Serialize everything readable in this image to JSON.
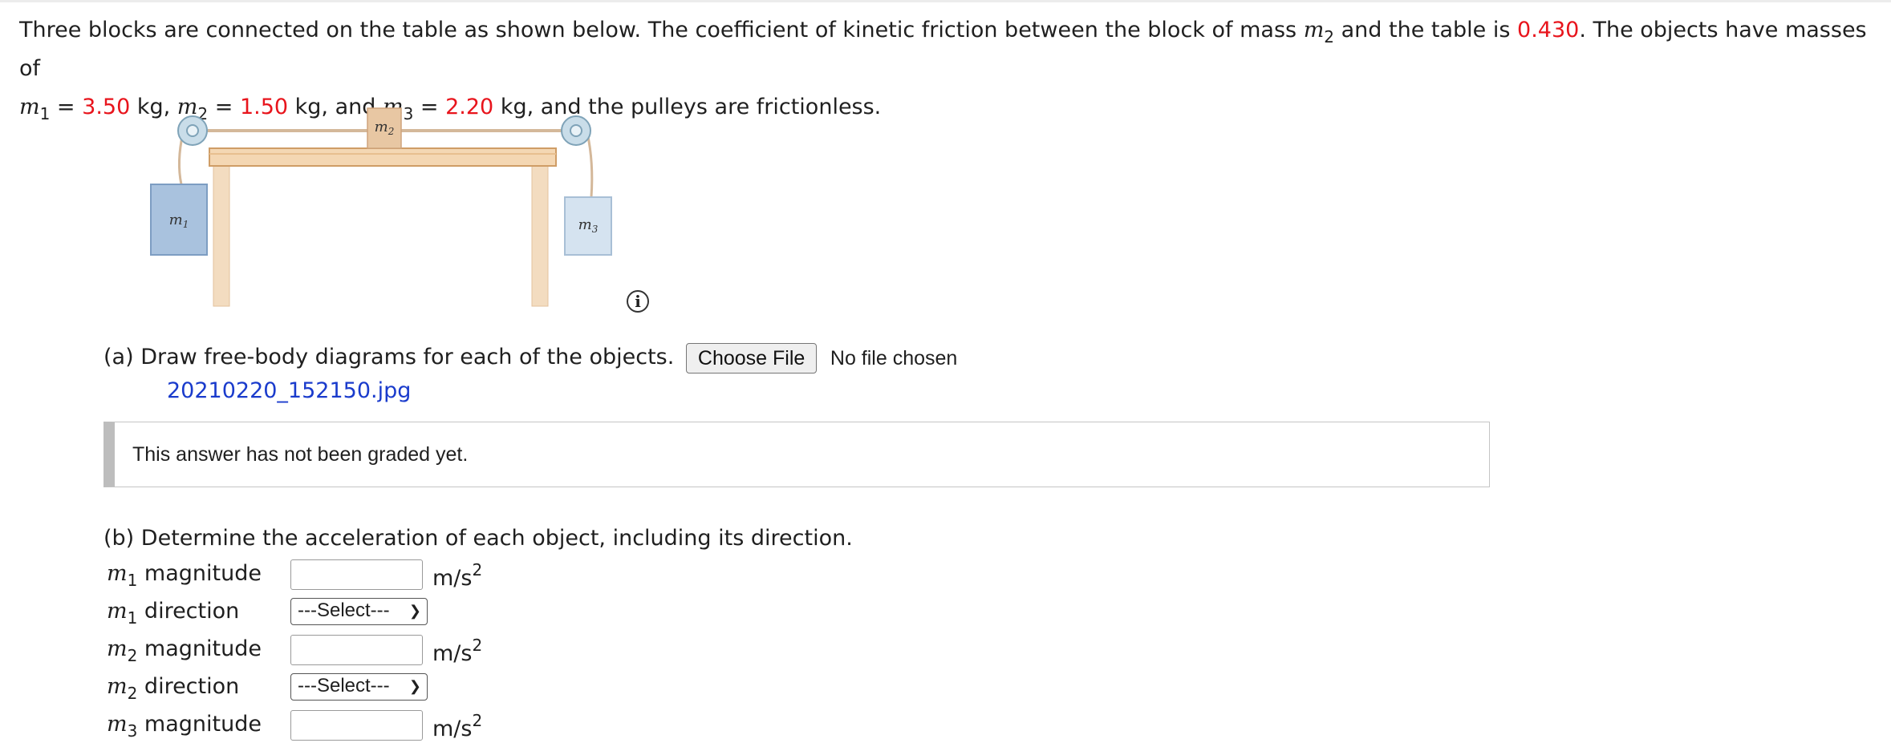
{
  "problem": {
    "intro": "Three blocks are connected on the table as shown below. The coefficient of kinetic friction between the block of mass ",
    "mid": " and the table is ",
    "mu": "0.430",
    "end": ". The objects have masses of",
    "m1_eq": " = ",
    "m1": "3.50",
    "kg1": " kg, ",
    "m2": "1.50",
    "kg2": " kg, and ",
    "m3": "2.20",
    "tail": " kg, and the pulleys are frictionless.",
    "var_m": "m",
    "sub1": "1",
    "sub2": "2",
    "sub3": "3"
  },
  "figure": {
    "label_m1": "m",
    "label_m2": "m",
    "label_m3": "m",
    "sub1": "1",
    "sub2": "2",
    "sub3": "3"
  },
  "info_icon": "i",
  "part_a": {
    "prompt": "(a) Draw free-body diagrams for each of the objects.",
    "button": "Choose File",
    "status": "No file chosen",
    "uploaded": "20210220_152150.jpg",
    "grade_note": "This answer has not been graded yet."
  },
  "part_b": {
    "prompt": "(b) Determine the acceleration of each object, including its direction.",
    "rows": [
      {
        "var": "m",
        "sub": "1",
        "label": " magnitude",
        "unit": "m/s",
        "exp": "2"
      },
      {
        "var": "m",
        "sub": "1",
        "label": " direction",
        "select": "---Select---"
      },
      {
        "var": "m",
        "sub": "2",
        "label": " magnitude",
        "unit": "m/s",
        "exp": "2"
      },
      {
        "var": "m",
        "sub": "2",
        "label": " direction",
        "select": "---Select---"
      },
      {
        "var": "m",
        "sub": "3",
        "label": " magnitude",
        "unit": "m/s",
        "exp": "2"
      }
    ]
  }
}
